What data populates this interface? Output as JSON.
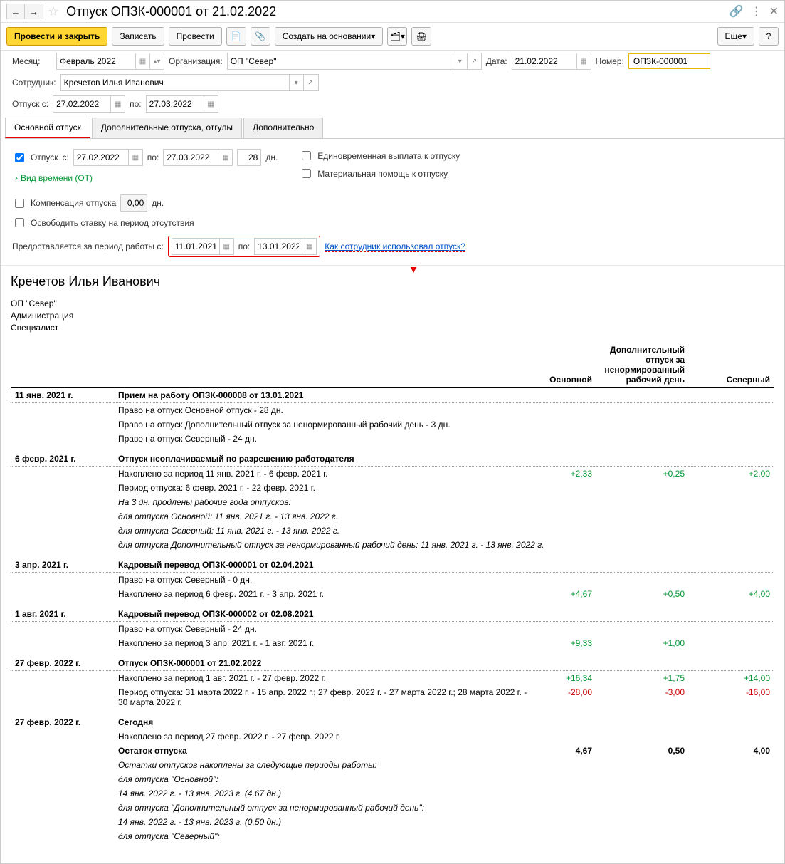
{
  "header": {
    "title": "Отпуск ОПЗК-000001 от 21.02.2022"
  },
  "toolbar": {
    "post_close": "Провести и закрыть",
    "save": "Записать",
    "post": "Провести",
    "based_on": "Создать на основании",
    "more": "Еще"
  },
  "form": {
    "month_label": "Месяц:",
    "month_value": "Февраль 2022",
    "org_label": "Организация:",
    "org_value": "ОП \"Север\"",
    "date_label": "Дата:",
    "date_value": "21.02.2022",
    "number_label": "Номер:",
    "number_value": "ОПЗК-000001",
    "employee_label": "Сотрудник:",
    "employee_value": "Кречетов Илья Иванович",
    "leave_from_label": "Отпуск с:",
    "leave_from": "27.02.2022",
    "leave_to_label": "по:",
    "leave_to": "27.03.2022"
  },
  "tabs": {
    "t1": "Основной отпуск",
    "t2": "Дополнительные отпуска, отгулы",
    "t3": "Дополнительно"
  },
  "main_tab": {
    "leave_checkbox": "Отпуск",
    "from_label": "с:",
    "from": "27.02.2022",
    "to_label": "по:",
    "to": "27.03.2022",
    "days": "28",
    "days_label": "дн.",
    "time_type": "Вид времени (ОТ)",
    "one_time_pay": "Единовременная выплата к отпуску",
    "material_aid": "Материальная помощь к отпуску",
    "compensation_label": "Компенсация отпуска",
    "compensation_value": "0,00",
    "compensation_days": "дн.",
    "free_position": "Освободить ставку на период отсутствия",
    "work_period_label": "Предоставляется за период работы с:",
    "wp_from": "11.01.2021",
    "wp_to_label": "по:",
    "wp_to": "13.01.2022",
    "how_used": "Как сотрудник использовал отпуск?"
  },
  "report": {
    "name": "Кречетов Илья Иванович",
    "org": "ОП \"Север\"",
    "dept": "Администрация",
    "pos": "Специалист",
    "col_main": "Основной",
    "col_extra": "Дополнительный отпуск за ненормированный рабочий день",
    "col_north": "Северный",
    "entries": [
      {
        "date": "11 янв. 2021 г.",
        "title": "Прием на работу ОПЗК-000008 от 13.01.2021",
        "lines": [
          "Право на отпуск Основной отпуск - 28 дн.",
          "Право на отпуск Дополнительный отпуск за ненормированный рабочий день - 3 дн.",
          "Право на отпуск Северный - 24 дн."
        ]
      },
      {
        "date": "6 февр. 2021 г.",
        "title": "Отпуск неоплачиваемый по разрешению работодателя",
        "vals": {
          "main": "+2,33",
          "extra": "+0,25",
          "north": "+2,00",
          "class": "pos"
        },
        "lines": [
          "Накоплено за период 11 янв. 2021 г. - 6 февр. 2021 г.",
          "Период отпуска: 6 февр. 2021 г. - 22 февр. 2021 г."
        ],
        "italic_lines": [
          "На 3 дн. продлены рабочие года отпусков:",
          "для отпуска Основной: 11 янв. 2021 г. - 13 янв. 2022 г.",
          "для отпуска Северный: 11 янв. 2021 г. - 13 янв. 2022 г.",
          "для отпуска Дополнительный отпуск за ненормированный рабочий день: 11 янв. 2021 г. - 13 янв. 2022 г."
        ]
      },
      {
        "date": "3 апр. 2021 г.",
        "title": "Кадровый перевод ОПЗК-000001 от 02.04.2021",
        "lines": [
          "Право на отпуск Северный - 0 дн."
        ],
        "vals": {
          "main": "+4,67",
          "extra": "+0,50",
          "north": "+4,00",
          "class": "pos"
        },
        "vals_line": "Накоплено за период 6 февр. 2021 г. - 3 апр. 2021 г."
      },
      {
        "date": "1 авг. 2021 г.",
        "title": "Кадровый перевод ОПЗК-000002 от 02.08.2021",
        "lines": [
          "Право на отпуск Северный - 24 дн."
        ],
        "vals": {
          "main": "+9,33",
          "extra": "+1,00",
          "north": "",
          "class": "pos"
        },
        "vals_line": "Накоплено за период 3 апр. 2021 г. - 1 авг. 2021 г."
      },
      {
        "date": "27 февр. 2022 г.",
        "title": "Отпуск ОПЗК-000001 от 21.02.2022",
        "vals": {
          "main": "+16,34",
          "extra": "+1,75",
          "north": "+14,00",
          "class": "pos"
        },
        "vals_line": "Накоплено за период 1 авг. 2021 г. - 27 февр. 2022 г.",
        "vals2": {
          "main": "-28,00",
          "extra": "-3,00",
          "north": "-16,00",
          "class": "neg"
        },
        "vals2_line": "Период отпуска: 31 марта 2022 г. - 15 апр. 2022 г.; 27 февр. 2022 г. - 27 марта 2022 г.; 28 марта 2022 г. - 30 марта 2022 г."
      },
      {
        "date": "27 февр. 2022 г.",
        "title": "Сегодня",
        "no_dotted": true,
        "lines": [
          "Накоплено за период 27 февр. 2022 г. - 27 февр. 2022 г."
        ],
        "bold_line": "Остаток отпуска",
        "bold_vals": {
          "main": "4,67",
          "extra": "0,50",
          "north": "4,00"
        },
        "italic_lines": [
          "Остатки отпусков накоплены за следующие периоды работы:",
          "для отпуска \"Основной\":",
          "14 янв. 2022 г. - 13 янв. 2023 г. (4,67 дн.)",
          "для отпуска \"Дополнительный отпуск за ненормированный рабочий день\":",
          "14 янв. 2022 г. - 13 янв. 2023 г. (0,50 дн.)",
          "для отпуска \"Северный\":"
        ]
      }
    ]
  }
}
